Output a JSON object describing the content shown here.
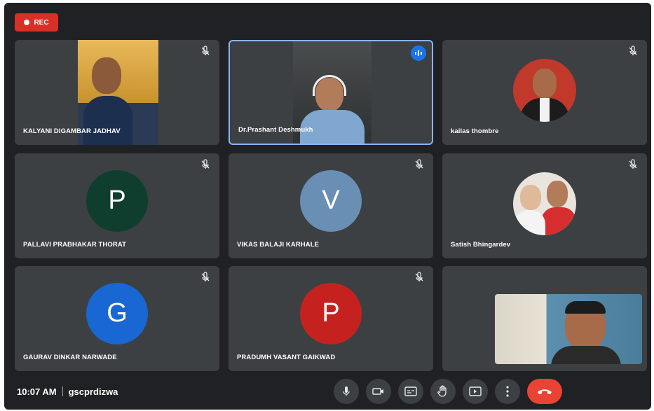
{
  "recording": {
    "label": "REC"
  },
  "participants": [
    {
      "name": "KALYANI DIGAMBAR JADHAV"
    },
    {
      "name": "Dr.Prashant Deshmukh"
    },
    {
      "name": "kailas thombre"
    },
    {
      "name": "PALLAVI PRABHAKAR THORAT",
      "initial": "P",
      "color": "#0f3d2e"
    },
    {
      "name": "VIKAS BALAJI KARHALE",
      "initial": "V",
      "color": "#6a8fb5"
    },
    {
      "name": "Satish Bhingardev"
    },
    {
      "name": "GAURAV DINKAR NARWADE",
      "initial": "G",
      "color": "#1967d2"
    },
    {
      "name": "PRADUMH VASANT GAIKWAD",
      "initial": "P",
      "color": "#c5221f"
    }
  ],
  "bottom_bar": {
    "time": "10:07 AM",
    "meeting_code": "gscprdizwa"
  },
  "colors": {
    "background": "#202124",
    "tile": "#3c4043",
    "end_call": "#ea4335",
    "active_border": "#8ab4f8"
  }
}
